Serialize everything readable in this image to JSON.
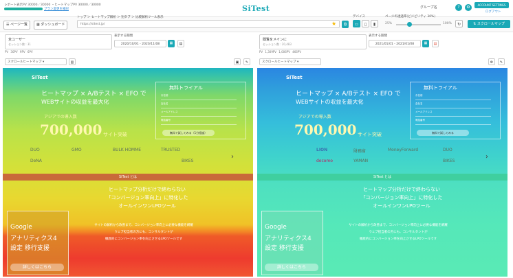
{
  "header": {
    "plan_text": "レポート表示PV 30000／30000 ・ヒートマップPV 30000／30000",
    "plan_fill_percent": 100,
    "plan_link": "プラン変更を検討",
    "logo": "SiTest",
    "group_name": "グループ名",
    "help_icon": "?",
    "gear_icon": "⚙",
    "account_label": "ACCOUNT SETTINGS",
    "logout_label": "ログアウト",
    "colors": {
      "accent": "#1aa9b6",
      "link": "#2f89d6"
    }
  },
  "toolbar": {
    "page_list_label": "ページ一覧",
    "dashboard_label": "ダッシュボード",
    "breadcrumb": "トップ ＞ ヒートマップ解析 ＞ 別タブ ＞ 比較解析ツール表示",
    "url_text": "https://sitest.jp/",
    "device_label": "デバイス",
    "devices": [
      "PC",
      "SP",
      "TAB"
    ],
    "opacity_label": "ページの透過率(ビジビリティ 30%)",
    "opacity_min": "25%",
    "opacity_max": "100%",
    "opacity_value_percent": 30,
    "scrollmap_button": "スクロールマップ"
  },
  "left_pane": {
    "segment_label": "全ユーザー",
    "segment_sub": "セッション数 : 31",
    "period_label": "表示する期間",
    "period_value": "2020/10/01 - 2020/11/08",
    "counts": "PV 30PV 9PV 6PV",
    "map_select": "スクロールヒートマップ",
    "landing": {
      "logo": "SiTest",
      "headline": "ヒートマップ × A/Bテスト × EFO で",
      "subline": "WEBサイトの収益を最大化",
      "count_label": "アジアでの導入数",
      "count": "700,000",
      "count_unit": "サイト突破",
      "trial_title": "無料トライアル",
      "trial_fields": [
        "お名前",
        "会社名",
        "メールアドレス",
        "電話番号"
      ],
      "trial_button": "無料で試してみる（1分程度）",
      "brands": [
        "DUO",
        "GMO",
        "BULK HOMME",
        "TRUSTED",
        "DeNA",
        "BIKES"
      ],
      "section_title": "SiTest とは",
      "body_1": "ヒートマップ分析だけで終わらない",
      "body_2": "「コンバージョン率向上」に特化した",
      "body_3": "オールインワンLPOツール",
      "small_1": "サイトの解析から改善まで、コンバージョン率向上に必要な機能を網羅",
      "small_2": "ウェブ担当者の方にも、コンサルタントが",
      "small_3": "徹底的にコンバージョン率を向上させるLPOツールです",
      "ga_1": "Google",
      "ga_2": "アナリティクス4",
      "ga_3": "設定 移行支援",
      "ga_button": "詳しくはこちら"
    }
  },
  "right_pane": {
    "segment_label": "閲覧をメインに",
    "segment_sub": "セッション数 : 20,483",
    "period_label": "表示する期間",
    "period_value": "2021/01/01 - 2021/01/08",
    "counts": "PV 1,309PV 1,006PV 466PV",
    "map_select": "スクロールヒートマップ",
    "landing": {
      "logo": "SiTest",
      "headline": "ヒートマップ × A/Bテスト × EFO で",
      "subline": "WEBサイトの収益を最大化",
      "count_label": "アジアでの導入数",
      "count": "700,000",
      "count_unit": "サイト突破",
      "trial_title": "無料トライアル",
      "trial_fields": [
        "お名前",
        "会社名",
        "メールアドレス",
        "電話番号"
      ],
      "trial_button": "無料で試してみる",
      "brands": [
        "LION",
        "財務省",
        "MoneyForward",
        "DUO",
        "docomo",
        "YAMAN",
        "BIKES"
      ],
      "section_title": "SiTest とは",
      "body_1": "ヒートマップ分析だけで終わらない",
      "body_2": "「コンバージョン率向上」に特化した",
      "body_3": "オールインワンLPOツール",
      "small_1": "サイトの解析から改善まで、コンバージョン率向上に必要な機能を網羅",
      "small_2": "ウェブ担当者の方にも、コンサルタントが",
      "small_3": "徹底的にコンバージョン率を向上させるLPOツールです",
      "ga_1": "Google",
      "ga_2": "アナリティクス4",
      "ga_3": "設定 移行支援",
      "ga_button": "詳しくはこちら"
    }
  }
}
